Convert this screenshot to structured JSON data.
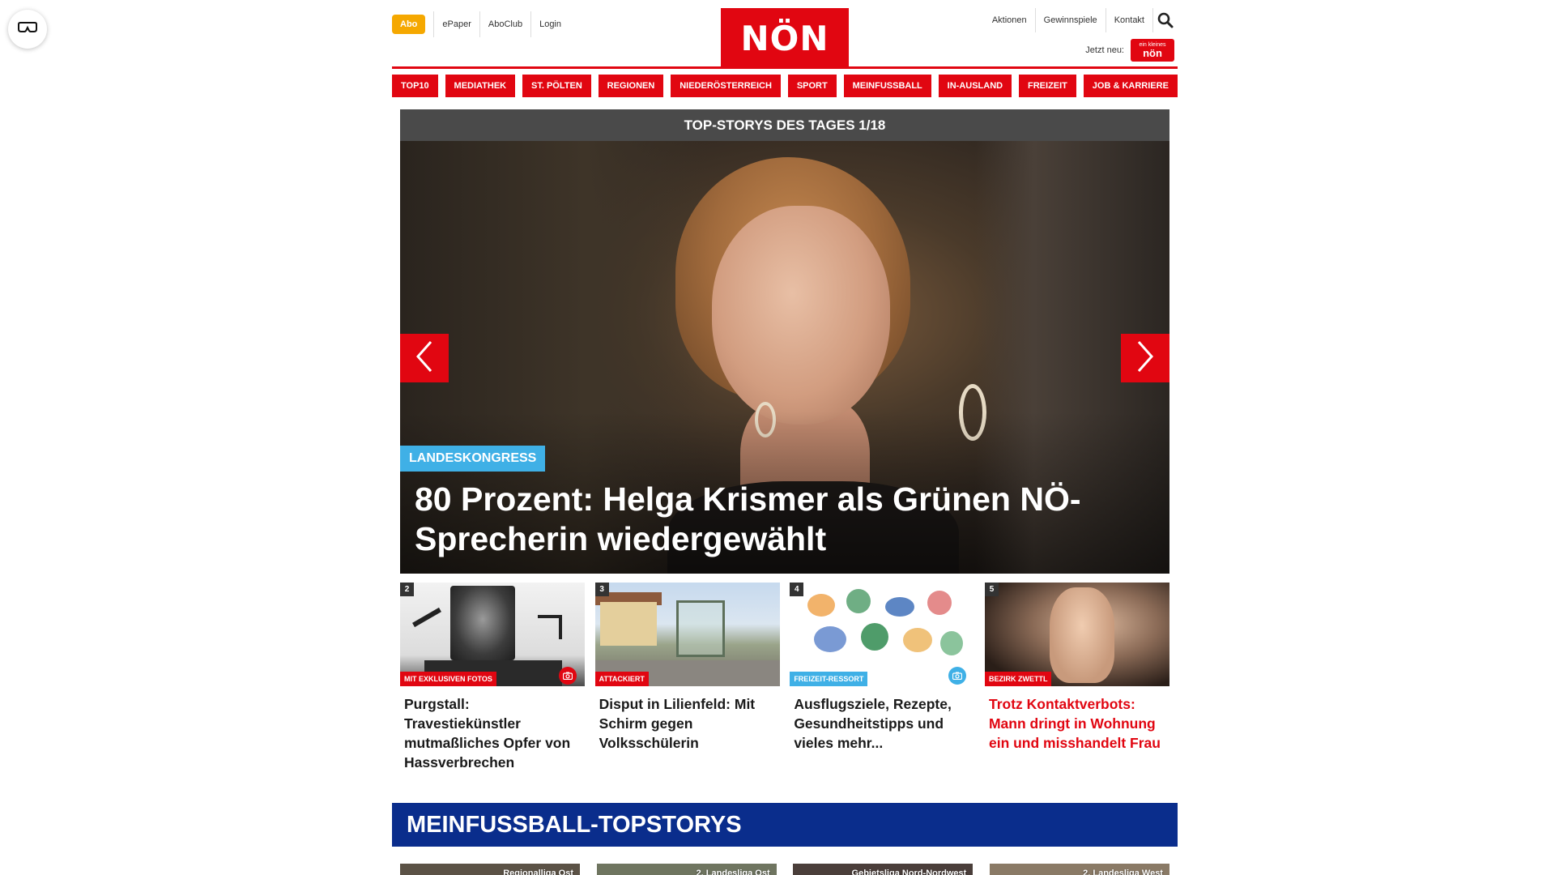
{
  "header": {
    "abo_label": "Abo",
    "top_links": [
      "ePaper",
      "AboClub",
      "Login"
    ],
    "logo_text": "NÖN",
    "right_links": [
      "Aktionen",
      "Gewinnspiele",
      "Kontakt"
    ],
    "jetzt_label": "Jetzt neu:",
    "mini_logo_top": "ein kleines",
    "mini_logo_bottom": "nön"
  },
  "nav": {
    "items": [
      "TOP10",
      "MEDIATHEK",
      "ST. PÖLTEN",
      "REGIONEN",
      "NIEDERÖSTERREICH",
      "SPORT",
      "MEINFUSSBALL",
      "IN-AUSLAND",
      "FREIZEIT",
      "JOB & KARRIERE"
    ]
  },
  "slider": {
    "header": "TOP-STORYS DES TAGES 1/18",
    "hero": {
      "tag": "LANDESKONGRESS",
      "title": "80 Prozent: Helga Krismer als Grünen NÖ-Sprecherin wiedergewählt"
    }
  },
  "cards": [
    {
      "num": "2",
      "tag": "MIT EXKLUSIVEN FOTOS",
      "tag_color": "#e10611",
      "title": "Purgstall: Travestiekünstler mutmaßliches Opfer von Hassverbrechen",
      "camera": true,
      "camera_color": "#e10611",
      "title_red": false
    },
    {
      "num": "3",
      "tag": "ATTACKIERT",
      "tag_color": "#e10611",
      "title": "Disput in Lilienfeld: Mit Schirm gegen Volksschülerin",
      "camera": false,
      "title_red": false
    },
    {
      "num": "4",
      "tag": "FREIZEIT-RESSORT",
      "tag_color": "#3fb0e6",
      "title": "Ausflugsziele, Rezepte, Gesundheitstipps und vieles mehr...",
      "camera": true,
      "camera_color": "#3fb0e6",
      "title_red": false
    },
    {
      "num": "5",
      "tag": "BEZIRK ZWETTL",
      "tag_color": "#e10611",
      "title": "Trotz Kontaktverbots: Mann dringt in Wohnung ein und misshandelt Frau",
      "camera": false,
      "title_red": true
    }
  ],
  "football": {
    "section_title": "MEINFUSSBALL-TOPSTORYS",
    "cards": [
      "Regionalliga Ost",
      "2. Landesliga Ost",
      "Gebietsliga Nord-Nordwest",
      "2. Landesliga West"
    ]
  },
  "colors": {
    "brand_red": "#e10611",
    "abo_orange": "#f5a800",
    "tag_blue": "#3fb0e6",
    "football_blue": "#0a2d8c",
    "slider_header_gray": "#4a4a4a"
  },
  "icons": [
    "vr-glasses-icon",
    "search-icon",
    "chevron-left-icon",
    "chevron-right-icon",
    "camera-icon"
  ]
}
